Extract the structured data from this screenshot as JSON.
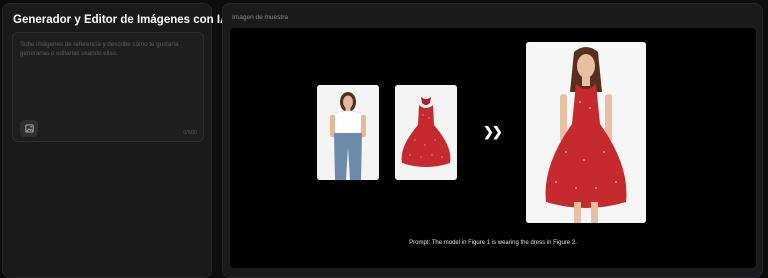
{
  "left": {
    "title": "Generador y Editor de Imágenes con IA",
    "prompt_placeholder": "Sube imágenes de referencia y describe cómo te gustaría generarlas o editarlas usando ellas.",
    "char_count": "0/500",
    "upload_icon": "image-upload-icon"
  },
  "right": {
    "label": "Imagen de muestra",
    "arrow_icon": "double-chevron-right-icon",
    "caption": "Prompt: The model in Figure 1 is wearing the dress in Figure 2."
  },
  "colors": {
    "panel": "#1a1a1c",
    "background": "#0d0d0e",
    "dress_red": "#c52a2e"
  }
}
